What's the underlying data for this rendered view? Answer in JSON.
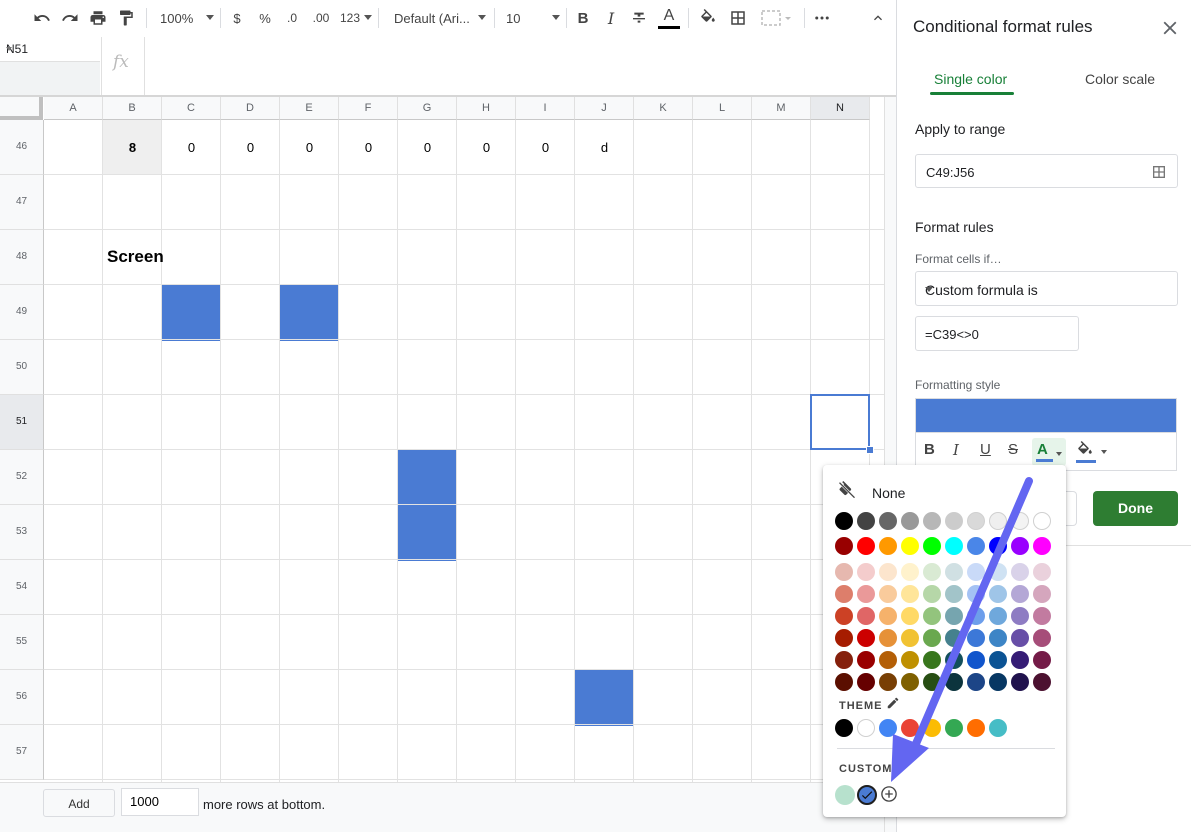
{
  "toolbar": {
    "zoom": "100%",
    "currency": "$",
    "percent": "%",
    "decrease_decimals": ".0",
    "increase_decimals": ".00",
    "more_formats": "123",
    "font": "Default (Ari...",
    "font_size": "10",
    "bold": "B",
    "italic": "I",
    "text_color_glyph": "A"
  },
  "formula_bar": {
    "name_box": "N51",
    "fx": "fx"
  },
  "grid": {
    "columns": [
      "A",
      "B",
      "C",
      "D",
      "E",
      "F",
      "G",
      "H",
      "I",
      "J",
      "K",
      "L",
      "M",
      "N"
    ],
    "selected_column": "N",
    "rows": [
      "46",
      "47",
      "48",
      "49",
      "50",
      "51",
      "52",
      "53",
      "54",
      "55",
      "56",
      "57"
    ],
    "selected_row": "51",
    "row46": {
      "B": "8",
      "C": "0",
      "D": "0",
      "E": "0",
      "F": "0",
      "G": "0",
      "H": "0",
      "I": "0",
      "J": "d"
    },
    "row48_label": "Screen",
    "highlighted_cells": [
      "C49",
      "E49",
      "G52",
      "G53",
      "J56"
    ],
    "highlight_color": "#4a7bd3",
    "selected_cell": "N51"
  },
  "add_rows": {
    "button": "Add",
    "count": "1000",
    "suffix": "more rows at bottom."
  },
  "panel": {
    "title": "Conditional format rules",
    "tabs": [
      "Single color",
      "Color scale"
    ],
    "active_tab": "Single color",
    "apply_to_range_label": "Apply to range",
    "range": "C49:J56",
    "format_rules_label": "Format rules",
    "format_cells_if_label": "Format cells if…",
    "condition": "Custom formula is",
    "formula": "=C39<>0",
    "formatting_style_label": "Formatting style",
    "style_buttons": {
      "bold": "B",
      "italic": "I",
      "underline": "U",
      "strikethrough": "S",
      "text_color": "A"
    },
    "done": "Done",
    "accent_color": "#188038"
  },
  "color_popup": {
    "none_label": "None",
    "palette": [
      [
        "#000000",
        "#434343",
        "#666666",
        "#999999",
        "#b7b7b7",
        "#cccccc",
        "#d9d9d9",
        "#efefef",
        "#f3f3f3",
        "#ffffff"
      ],
      [
        "#980000",
        "#ff0000",
        "#ff9900",
        "#ffff00",
        "#00ff00",
        "#00ffff",
        "#4a86e8",
        "#0000ff",
        "#9900ff",
        "#ff00ff"
      ],
      [
        "#e6b8af",
        "#f4cccc",
        "#fce5cd",
        "#fff2cc",
        "#d9ead3",
        "#d0e0e3",
        "#c9daf8",
        "#cfe2f3",
        "#d9d2e9",
        "#ead1dc"
      ],
      [
        "#dd7e6b",
        "#ea9999",
        "#f9cb9c",
        "#ffe599",
        "#b6d7a8",
        "#a2c4c9",
        "#a4c2f4",
        "#9fc5e8",
        "#b4a7d6",
        "#d5a6bd"
      ],
      [
        "#cc4125",
        "#e06666",
        "#f6b26b",
        "#ffd966",
        "#93c47d",
        "#76a5af",
        "#6d9eeb",
        "#6fa8dc",
        "#8e7cc3",
        "#c27ba0"
      ],
      [
        "#a61c00",
        "#cc0000",
        "#e69138",
        "#f1c232",
        "#6aa84f",
        "#45818e",
        "#3c78d8",
        "#3d85c6",
        "#674ea7",
        "#a64d79"
      ],
      [
        "#85200c",
        "#990000",
        "#b45f06",
        "#bf9000",
        "#38761d",
        "#134f5c",
        "#1155cc",
        "#0b5394",
        "#351c75",
        "#741b47"
      ],
      [
        "#5b0f00",
        "#660000",
        "#783f04",
        "#7f6000",
        "#274e13",
        "#0c343d",
        "#1c4587",
        "#073763",
        "#20124d",
        "#4c1130"
      ]
    ],
    "theme_label": "THEME",
    "theme_colors": [
      "#000000",
      "#ffffff",
      "#4285f4",
      "#ea4335",
      "#fbbc04",
      "#34a853",
      "#ff6d01",
      "#46bdc6"
    ],
    "custom_label": "CUSTOM",
    "custom_colors": [
      "#b7e1cd",
      "#4a7bd3"
    ],
    "arrow_color": "#6366f1"
  }
}
